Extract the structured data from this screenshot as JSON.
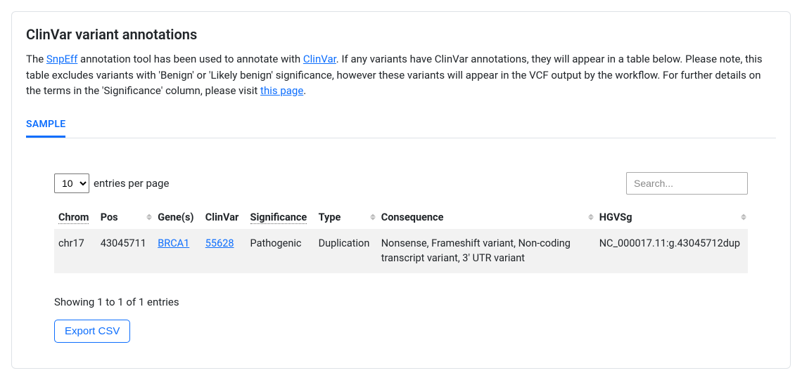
{
  "card": {
    "title": "ClinVar variant annotations",
    "description_parts": {
      "p1": "The ",
      "link1": "SnpEff",
      "p2": " annotation tool has been used to annotate with ",
      "link2": "ClinVar",
      "p3": ". If any variants have ClinVar annotations, they will appear in a table below. Please note, this table excludes variants with 'Benign' or 'Likely benign' significance, however these variants will appear in the VCF output by the workflow. For further details on the terms in the 'Significance' column, please visit ",
      "link3": "this page",
      "p4": "."
    }
  },
  "tabs": {
    "active": "SAMPLE"
  },
  "controls": {
    "entries_select_value": "10",
    "entries_label": "entries per page",
    "search_placeholder": "Search..."
  },
  "columns": {
    "chrom": "Chrom",
    "pos": "Pos",
    "genes": "Gene(s)",
    "clinvar": "ClinVar",
    "significance": "Significance",
    "type": "Type",
    "consequence": "Consequence",
    "hgvsg": "HGVSg"
  },
  "rows": [
    {
      "chrom": "chr17",
      "pos": "43045711",
      "gene": "BRCA1",
      "clinvar": "55628",
      "significance": "Pathogenic",
      "type": "Duplication",
      "consequence": "Nonsense, Frameshift variant, Non-coding transcript variant, 3' UTR variant",
      "hgvsg": "NC_000017.11:g.43045712dup"
    }
  ],
  "footer": {
    "showing": "Showing 1 to 1 of 1 entries",
    "export_btn": "Export CSV"
  }
}
